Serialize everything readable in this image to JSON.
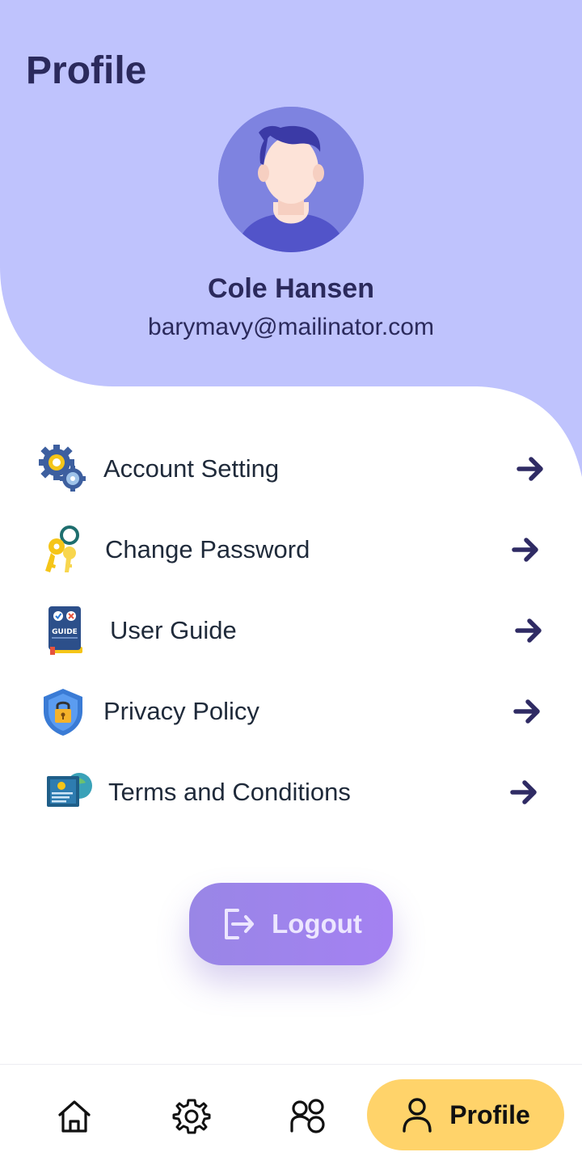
{
  "page": {
    "title": "Profile"
  },
  "user": {
    "name": "Cole Hansen",
    "email": "barymavy@mailinator.com"
  },
  "menu": {
    "items": [
      {
        "label": "Account Setting",
        "icon": "gears-icon"
      },
      {
        "label": "Change Password",
        "icon": "keys-icon"
      },
      {
        "label": "User Guide",
        "icon": "guide-book-icon"
      },
      {
        "label": "Privacy Policy",
        "icon": "shield-lock-icon"
      },
      {
        "label": "Terms and Conditions",
        "icon": "document-certificate-icon"
      }
    ]
  },
  "logout": {
    "label": "Logout",
    "icon": "logout-icon"
  },
  "bottom_nav": {
    "items": [
      {
        "icon": "home-icon"
      },
      {
        "icon": "settings-gear-icon"
      },
      {
        "icon": "group-icon"
      },
      {
        "icon": "user-icon",
        "label": "Profile",
        "active": true
      }
    ]
  },
  "colors": {
    "header_background": "#bfc3fd",
    "text_primary": "#2b2a5c",
    "logout_gradient_start": "#9986e6",
    "logout_gradient_end": "#a481f2",
    "active_nav_background": "#ffd36a",
    "arrow": "#2f2b64"
  }
}
